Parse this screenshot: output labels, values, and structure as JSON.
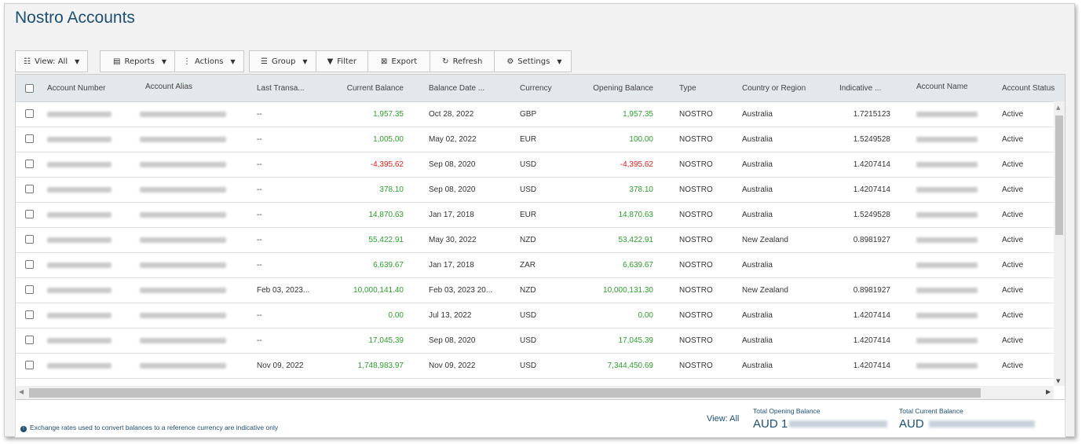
{
  "title": "Nostro Accounts",
  "toolbar": {
    "view": "View: All",
    "reports": "Reports",
    "actions": "Actions",
    "group": "Group",
    "filter": "Filter",
    "export": "Export",
    "refresh": "Refresh",
    "settings": "Settings"
  },
  "columns": [
    "Account Number",
    "Account Alias",
    "Last Transa...",
    "Current Balance",
    "Balance Date ...",
    "Currency",
    "Opening Balance",
    "Type",
    "Country or Region",
    "Indicative ...",
    "Account Name",
    "Account Status"
  ],
  "rows": [
    {
      "last": "--",
      "current": "1,957.35",
      "cur_neg": false,
      "date": "Oct 28, 2022",
      "currency": "GBP",
      "opening": "1,957.35",
      "open_neg": false,
      "type": "NOSTRO",
      "country": "Australia",
      "rate": "1.7215123",
      "status": "Active"
    },
    {
      "last": "--",
      "current": "1,005.00",
      "cur_neg": false,
      "date": "May 02, 2022",
      "currency": "EUR",
      "opening": "100.00",
      "open_neg": false,
      "type": "NOSTRO",
      "country": "Australia",
      "rate": "1.5249528",
      "status": "Active"
    },
    {
      "last": "--",
      "current": "-4,395.62",
      "cur_neg": true,
      "date": "Sep 08, 2020",
      "currency": "USD",
      "opening": "-4,395.62",
      "open_neg": true,
      "type": "NOSTRO",
      "country": "Australia",
      "rate": "1.4207414",
      "status": "Active"
    },
    {
      "last": "--",
      "current": "378.10",
      "cur_neg": false,
      "date": "Sep 08, 2020",
      "currency": "USD",
      "opening": "378.10",
      "open_neg": false,
      "type": "NOSTRO",
      "country": "Australia",
      "rate": "1.4207414",
      "status": "Active"
    },
    {
      "last": "--",
      "current": "14,870.63",
      "cur_neg": false,
      "date": "Jan 17, 2018",
      "currency": "EUR",
      "opening": "14,870.63",
      "open_neg": false,
      "type": "NOSTRO",
      "country": "Australia",
      "rate": "1.5249528",
      "status": "Active"
    },
    {
      "last": "--",
      "current": "55,422.91",
      "cur_neg": false,
      "date": "May 30, 2022",
      "currency": "NZD",
      "opening": "53,422.91",
      "open_neg": false,
      "type": "NOSTRO",
      "country": "New Zealand",
      "rate": "0.8981927",
      "status": "Active"
    },
    {
      "last": "--",
      "current": "6,639.67",
      "cur_neg": false,
      "date": "Jan 17, 2018",
      "currency": "ZAR",
      "opening": "6,639.67",
      "open_neg": false,
      "type": "NOSTRO",
      "country": "Australia",
      "rate": "",
      "status": "Active"
    },
    {
      "last": "Feb 03, 2023...",
      "current": "10,000,141.40",
      "cur_neg": false,
      "date": "Feb 03, 2023 20...",
      "currency": "NZD",
      "opening": "10,000,131.30",
      "open_neg": false,
      "type": "NOSTRO",
      "country": "New Zealand",
      "rate": "0.8981927",
      "status": "Active"
    },
    {
      "last": "--",
      "current": "0.00",
      "cur_neg": false,
      "date": "Jul 13, 2022",
      "currency": "USD",
      "opening": "0.00",
      "open_neg": false,
      "type": "NOSTRO",
      "country": "Australia",
      "rate": "1.4207414",
      "status": "Active"
    },
    {
      "last": "--",
      "current": "17,045.39",
      "cur_neg": false,
      "date": "Sep 08, 2020",
      "currency": "USD",
      "opening": "17,045.39",
      "open_neg": false,
      "type": "NOSTRO",
      "country": "Australia",
      "rate": "1.4207414",
      "status": "Active"
    },
    {
      "last": "Nov 09, 2022",
      "current": "1,748,983.97",
      "cur_neg": false,
      "date": "Nov 09, 2022",
      "currency": "USD",
      "opening": "7,344,450.69",
      "open_neg": false,
      "type": "NOSTRO",
      "country": "Australia",
      "rate": "1.4207414",
      "status": "Active"
    }
  ],
  "footer": {
    "note": "Exchange rates used to convert balances to a reference currency are indicative only",
    "view": "View: All",
    "opening_label": "Total Opening Balance",
    "opening_prefix": "AUD 1",
    "current_label": "Total Current Balance",
    "current_prefix": "AUD"
  },
  "colors": {
    "positive": "#2ea02e",
    "negative": "#e0201f",
    "title": "#1d4f73"
  }
}
